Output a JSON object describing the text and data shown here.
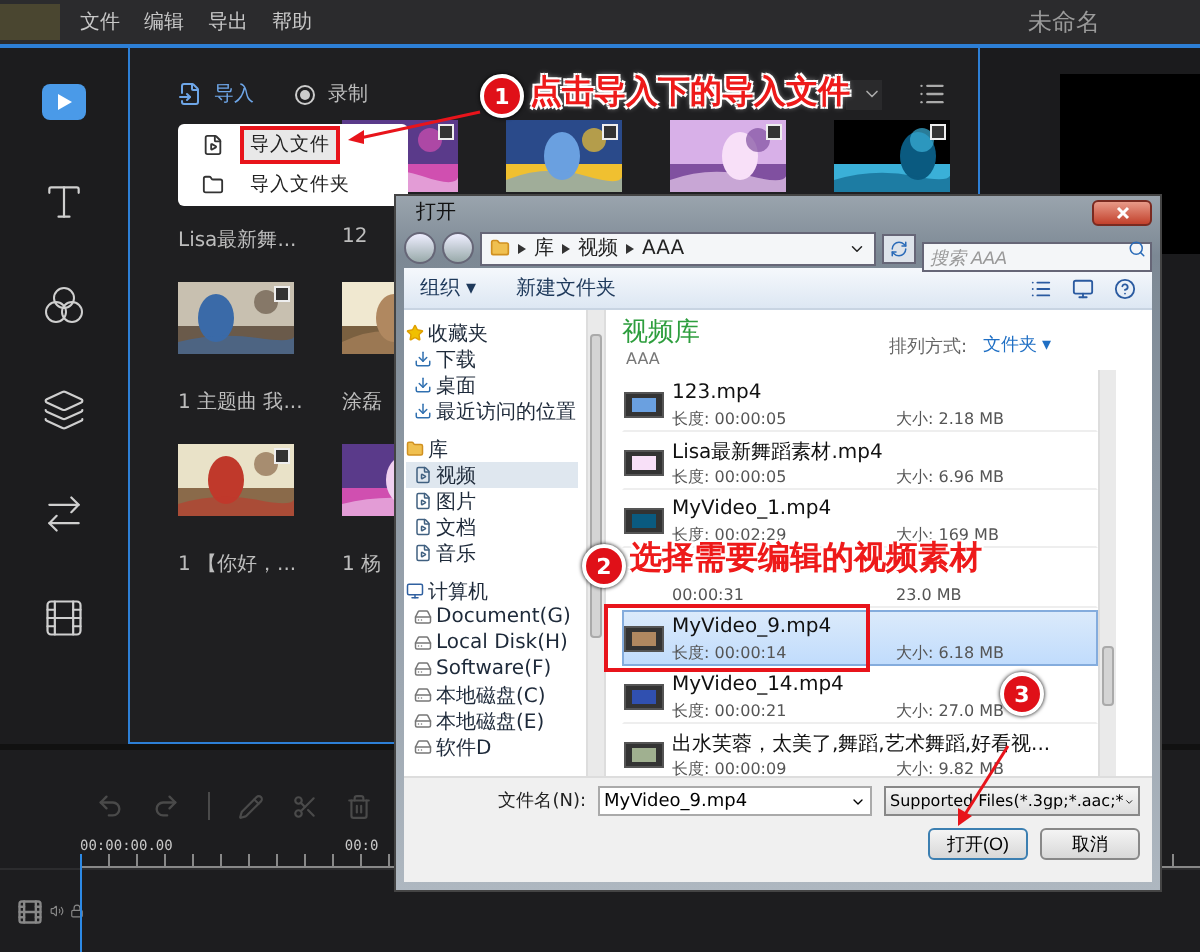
{
  "app": {
    "menu": [
      "文件",
      "编辑",
      "导出",
      "帮助"
    ],
    "title": "未命名"
  },
  "media": {
    "import_label": "导入",
    "record_label": "录制",
    "import_menu": [
      {
        "label": "导入文件",
        "highlighted": true
      },
      {
        "label": "导入文件夹",
        "highlighted": false
      }
    ],
    "items": [
      {
        "label": "Lisa最新舞...",
        "kind": "hidden"
      },
      {
        "label": "12",
        "kind": "picture",
        "checked": false
      },
      {
        "kind": "picture",
        "checked": false
      },
      {
        "kind": "picture",
        "checked": false
      },
      {
        "kind": "picture",
        "checked": false
      },
      {
        "label": "1 主题曲 我...",
        "kind": "picture",
        "checked": false
      },
      {
        "label": "涂磊",
        "kind": "cut_picture"
      },
      {
        "kind": "hidden"
      },
      {
        "kind": "hidden"
      },
      {
        "kind": "hidden"
      },
      {
        "label": "1 【你好，...",
        "kind": "picture",
        "checked": false
      },
      {
        "label": "1 杨",
        "kind": "cut_picture"
      }
    ]
  },
  "timeline": {
    "time_start": "00:00:00.00",
    "time_next": "00:0"
  },
  "dialog": {
    "title": "打开",
    "path": [
      "库",
      "视频",
      "AAA"
    ],
    "search": {
      "placeholder": "搜索 AAA"
    },
    "toolbar": [
      "组织 ▾",
      "新建文件夹"
    ],
    "nav": [
      {
        "label": "收藏夹",
        "selected": false,
        "children": [
          {
            "label": "下载",
            "selected": false
          },
          {
            "label": "桌面",
            "selected": false
          },
          {
            "label": "最近访问的位置",
            "selected": false
          }
        ]
      },
      {
        "label": "库",
        "selected": false,
        "children": [
          {
            "label": "视频",
            "selected": true
          },
          {
            "label": "图片",
            "selected": false
          },
          {
            "label": "文档",
            "selected": false
          },
          {
            "label": "音乐",
            "selected": false
          }
        ]
      },
      {
        "label": "计算机",
        "selected": false,
        "children": [
          {
            "label": "Document(G)",
            "selected": false
          },
          {
            "label": "Local Disk(H)",
            "selected": false
          },
          {
            "label": "Software(F)",
            "selected": false
          },
          {
            "label": "本地磁盘(C)",
            "selected": false
          },
          {
            "label": "本地磁盘(E)",
            "selected": false
          },
          {
            "label": "软件D",
            "selected": false
          }
        ]
      }
    ],
    "library_title": "视频库",
    "library_sub": "AAA",
    "sort_label": "排列方式:",
    "sort_value": "文件夹 ▾",
    "files": [
      {
        "name": "123.mp4",
        "length": "长度: 00:00:05",
        "size": "大小: 2.18 MB",
        "selected": false
      },
      {
        "name": "Lisa最新舞蹈素材.mp4",
        "length": "长度: 00:00:05",
        "size": "大小: 6.96 MB",
        "selected": false
      },
      {
        "name": "MyVideo_1.mp4",
        "length": "长度: 00:02:29",
        "size": "大小: 169 MB",
        "selected": false
      },
      {
        "length": "00:00:31",
        "size": "23.0 MB",
        "selected": false
      },
      {
        "name": "MyVideo_9.mp4",
        "length": "长度: 00:00:14",
        "size": "大小: 6.18 MB",
        "selected": true
      },
      {
        "name": "MyVideo_14.mp4",
        "length": "长度: 00:00:21",
        "size": "大小: 27.0 MB",
        "selected": false
      },
      {
        "name": "出水芙蓉，太美了,舞蹈,艺术舞蹈,好看视...",
        "length": "长度: 00:00:09",
        "size": "大小: 9.82 MB",
        "selected": false
      }
    ],
    "filename_label": "文件名(N):",
    "filename": "MyVideo_9.mp4",
    "filter": "Supported Files(*.3gp;*.aac;*",
    "open_button": "打开(O)",
    "cancel_button": "取消"
  },
  "annotations": [
    {
      "number": "1",
      "text": "点击导入下的导入文件"
    },
    {
      "number": "2",
      "text": "选择需要编辑的视频素材"
    },
    {
      "number": "3"
    }
  ]
}
